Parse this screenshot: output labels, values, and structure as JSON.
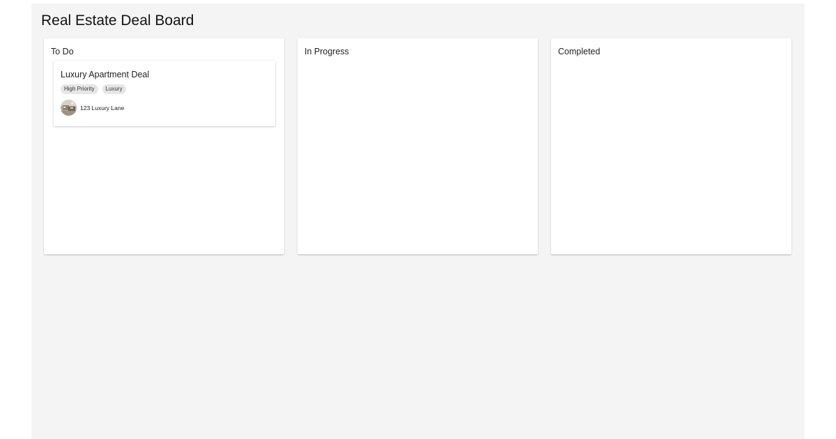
{
  "board": {
    "title": "Real Estate Deal Board"
  },
  "columns": [
    {
      "title": "To Do",
      "cards": [
        {
          "title": "Luxury Apartment Deal",
          "tags": [
            "High Priority",
            "Luxury"
          ],
          "address": "123 Luxury Lane",
          "avatar_icon": "property-photo-avatar"
        }
      ]
    },
    {
      "title": "In Progress",
      "cards": []
    },
    {
      "title": "Completed",
      "cards": []
    }
  ],
  "colors": {
    "board_background": "#f4f4f4",
    "column_background": "#ffffff",
    "tag_background": "#e6e6e6"
  }
}
